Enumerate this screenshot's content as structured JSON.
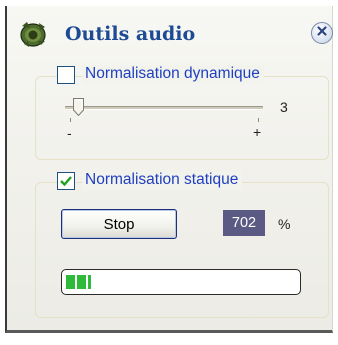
{
  "window": {
    "title": "Outils audio",
    "app_icon": "audio-tools-icon",
    "close_icon": "close-icon"
  },
  "dynamic_normalization": {
    "label": "Normalisation dynamique",
    "checked": false,
    "slider": {
      "value": "3",
      "level_fraction": 0.05,
      "min_label": "-",
      "max_label": "+"
    }
  },
  "static_normalization": {
    "label": "Normalisation statique",
    "checked": true,
    "stop_button_label": "Stop",
    "value": "702",
    "unit": "%",
    "progress_fraction": 0.11
  },
  "colors": {
    "title": "#1d4a94",
    "legend": "#1f3fbf",
    "value_box": "#5b5a84",
    "progress": "#2fbb3a"
  }
}
